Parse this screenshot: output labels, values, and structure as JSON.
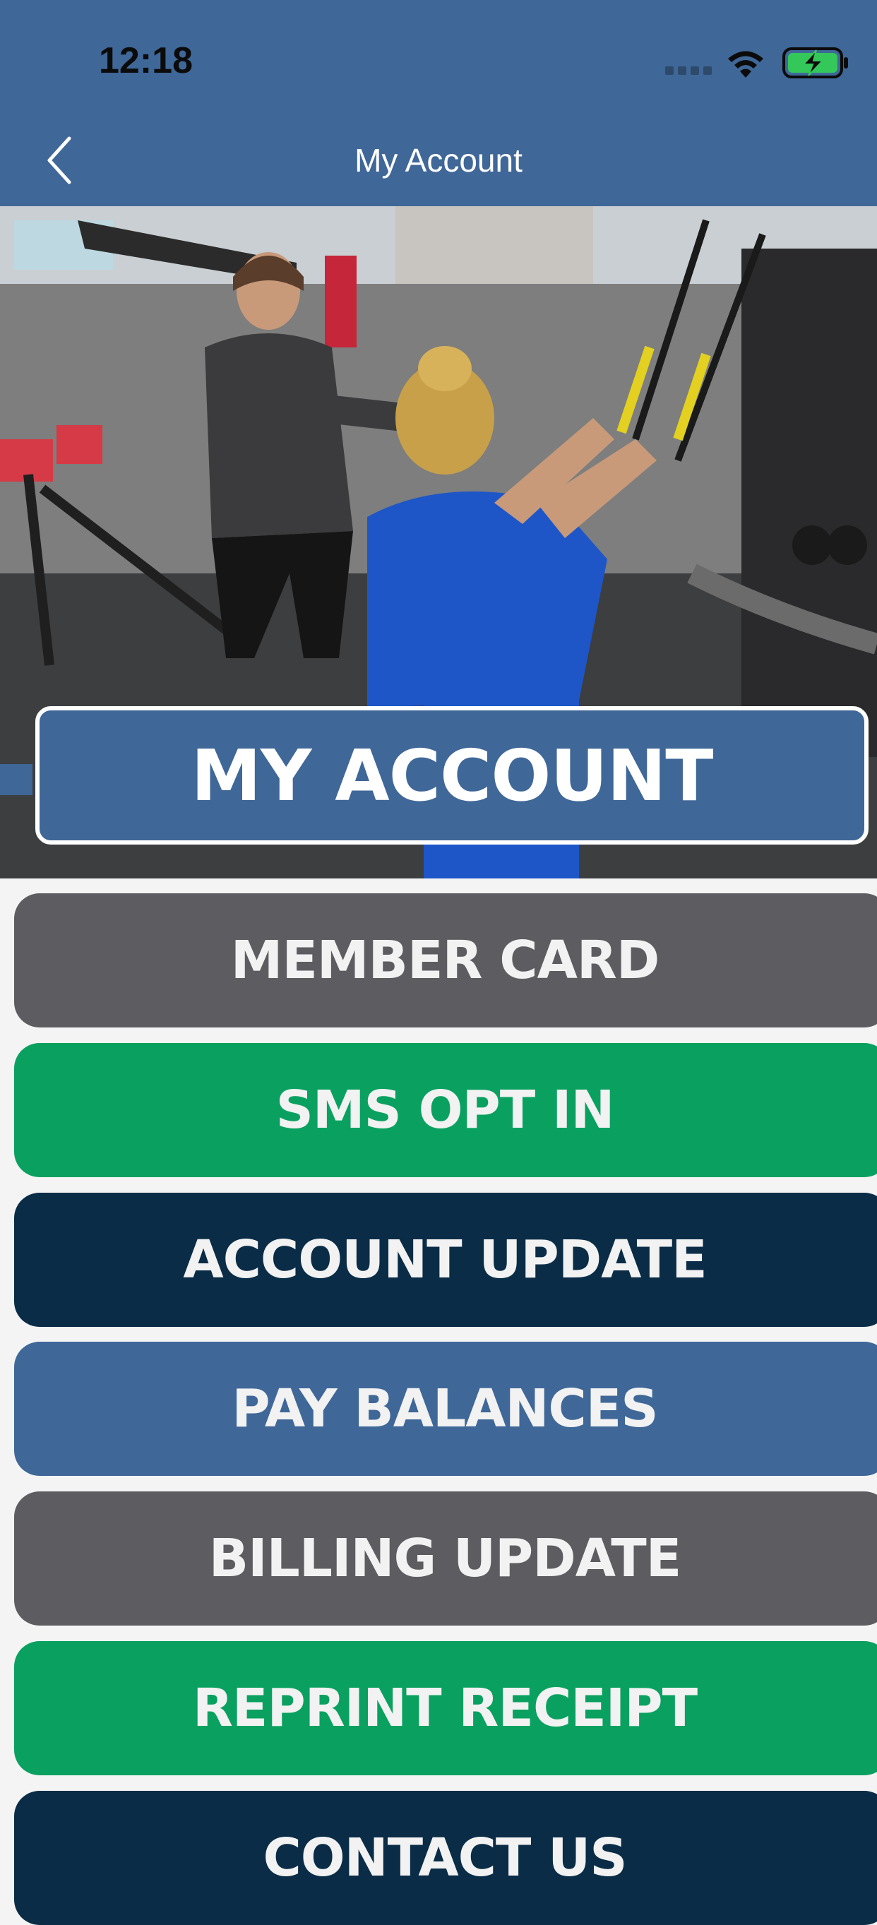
{
  "status_bar": {
    "time": "12:18",
    "icons": [
      "cellular-signal-icon",
      "wifi-icon",
      "battery-charging-icon"
    ]
  },
  "nav": {
    "title": "My Account",
    "back_icon": "chevron-left-icon"
  },
  "hero": {
    "banner_label": "MY ACCOUNT",
    "banner_color": "#3f6798"
  },
  "menu": {
    "items": [
      {
        "label": "MEMBER CARD",
        "color": "#5d5c60",
        "text_color": "#f2f2f2"
      },
      {
        "label": "SMS OPT IN",
        "color": "#0aa160",
        "text_color": "#f2f2f2"
      },
      {
        "label": "ACCOUNT UPDATE",
        "color": "#0a2c46",
        "text_color": "#f2f2f2"
      },
      {
        "label": "PAY BALANCES",
        "color": "#3f6798",
        "text_color": "#f2f2f2"
      },
      {
        "label": "BILLING UPDATE",
        "color": "#5d5c60",
        "text_color": "#f2f2f2"
      },
      {
        "label": "REPRINT RECEIPT",
        "color": "#0aa160",
        "text_color": "#f2f2f2"
      },
      {
        "label": "CONTACT US",
        "color": "#0a2c46",
        "text_color": "#f2f2f2"
      }
    ]
  }
}
